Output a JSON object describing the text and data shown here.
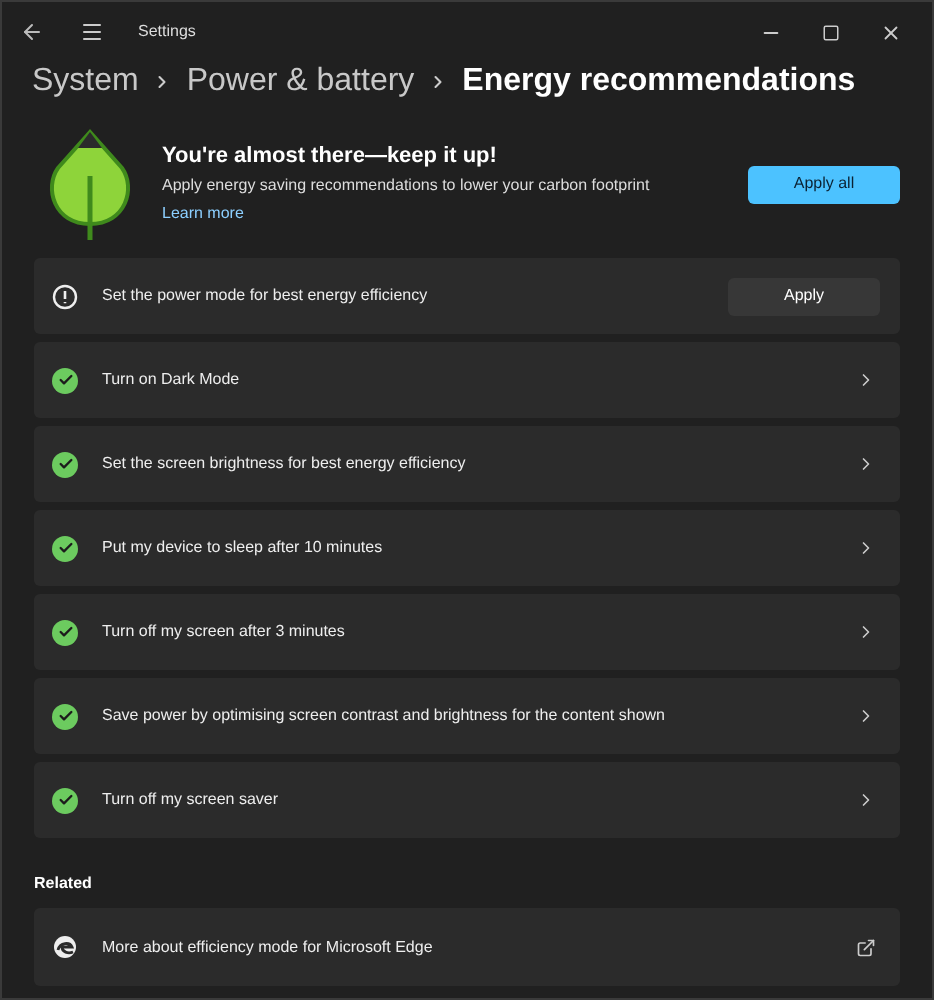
{
  "window": {
    "title": "Settings"
  },
  "breadcrumb": [
    {
      "label": "System",
      "current": false
    },
    {
      "label": "Power & battery",
      "current": false
    },
    {
      "label": "Energy recommendations",
      "current": true
    }
  ],
  "hero": {
    "heading": "You're almost there—keep it up!",
    "description": "Apply energy saving recommendations to lower your carbon footprint",
    "link": "Learn more",
    "button": "Apply all"
  },
  "recommendations": [
    {
      "kind": "pending",
      "label": "Set the power mode for best energy efficiency",
      "button": "Apply"
    },
    {
      "kind": "done",
      "label": "Turn on Dark Mode"
    },
    {
      "kind": "done",
      "label": "Set the screen brightness for best energy efficiency"
    },
    {
      "kind": "done",
      "label": "Put my device to sleep after 10 minutes"
    },
    {
      "kind": "done",
      "label": "Turn off my screen after 3 minutes"
    },
    {
      "kind": "done",
      "label": "Save power by optimising screen contrast and brightness for the content shown"
    },
    {
      "kind": "done",
      "label": "Turn off my screen saver"
    }
  ],
  "related": {
    "heading": "Related",
    "items": [
      {
        "label": "More about efficiency mode for Microsoft Edge"
      }
    ]
  }
}
